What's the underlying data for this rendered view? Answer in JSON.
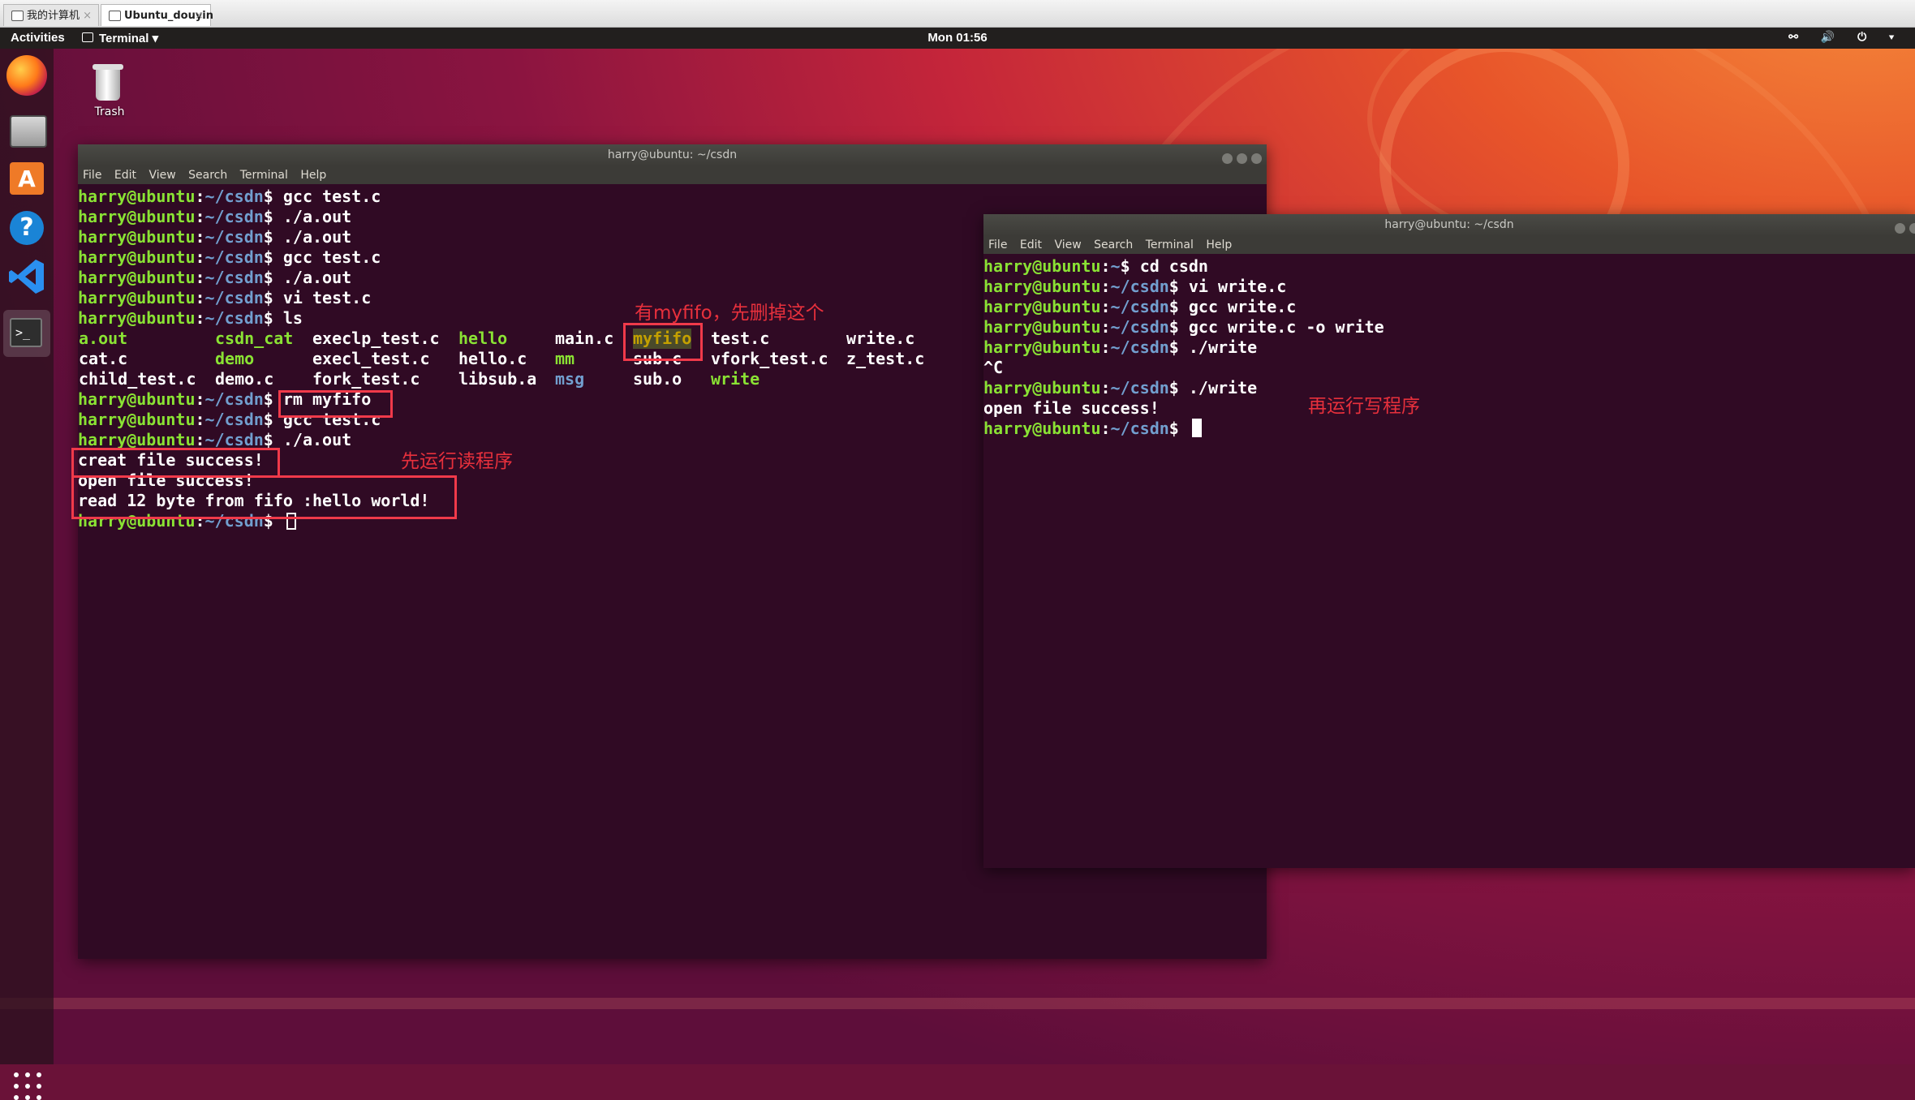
{
  "vm_tabs": [
    {
      "label": "我的计算机",
      "close": "×"
    },
    {
      "label": "Ubuntu_douyin",
      "close": "×"
    }
  ],
  "topbar": {
    "activities": "Activities",
    "app_menu": "Terminal ▾",
    "clock": "Mon 01:56",
    "tray_icons": [
      "network-icon",
      "volume-icon",
      "power-icon"
    ],
    "tray_text": "⚯ 🔊 ⏻ ▾"
  },
  "desktop": {
    "trash_label": "Trash"
  },
  "dock": {
    "terminal_glyph": ">_",
    "software_glyph": "A",
    "help_glyph": "?"
  },
  "colors": {
    "prompt_user": "#8ae234",
    "prompt_path": "#729fcf",
    "terminal_bg": "#300a24",
    "annotation": "#f03a4a"
  },
  "term_left": {
    "title": "harry@ubuntu: ~/csdn",
    "menu": [
      "File",
      "Edit",
      "View",
      "Search",
      "Terminal",
      "Help"
    ],
    "prompt_user": "harry@ubuntu",
    "prompt_sep": ":",
    "prompt_path": "~/csdn",
    "prompt_end": "$ ",
    "commands": [
      "gcc test.c",
      "./a.out",
      "./a.out",
      "gcc test.c",
      "./a.out",
      "vi test.c",
      "ls"
    ],
    "ls": [
      [
        "a.out",
        "csdn_cat",
        "execlp_test.c",
        "hello",
        "main.c",
        "myfifo",
        "test.c",
        "write.c"
      ],
      [
        "cat.c",
        "demo",
        "execl_test.c",
        "hello.c",
        "mm",
        "sub.c",
        "vfork_test.c",
        "z_test.c"
      ],
      [
        "child_test.c",
        "demo.c",
        "fork_test.c",
        "libsub.a",
        "msg",
        "sub.o",
        "write",
        ""
      ]
    ],
    "commands2": [
      "rm myfifo",
      "gcc test.c",
      "./a.out"
    ],
    "output": [
      "creat file success!",
      "open file success!",
      "read 12 byte from fifo :hello world!"
    ]
  },
  "term_right": {
    "title": "harry@ubuntu: ~/csdn",
    "menu": [
      "File",
      "Edit",
      "View",
      "Search",
      "Terminal",
      "Help"
    ],
    "prompt_user": "harry@ubuntu",
    "prompt_sep": ":",
    "prompt_home": "~",
    "prompt_path": "~/csdn",
    "prompt_end": "$ ",
    "commands": [
      "cd csdn",
      "vi write.c",
      "gcc write.c",
      "gcc write.c -o write",
      "./write",
      "./write"
    ],
    "interrupt": "^C",
    "output": "open file success!"
  },
  "annotations": {
    "myfifo_note": "有myfifo，先删掉这个",
    "read_first": "先运行读程序",
    "write_next": "再运行写程序"
  }
}
